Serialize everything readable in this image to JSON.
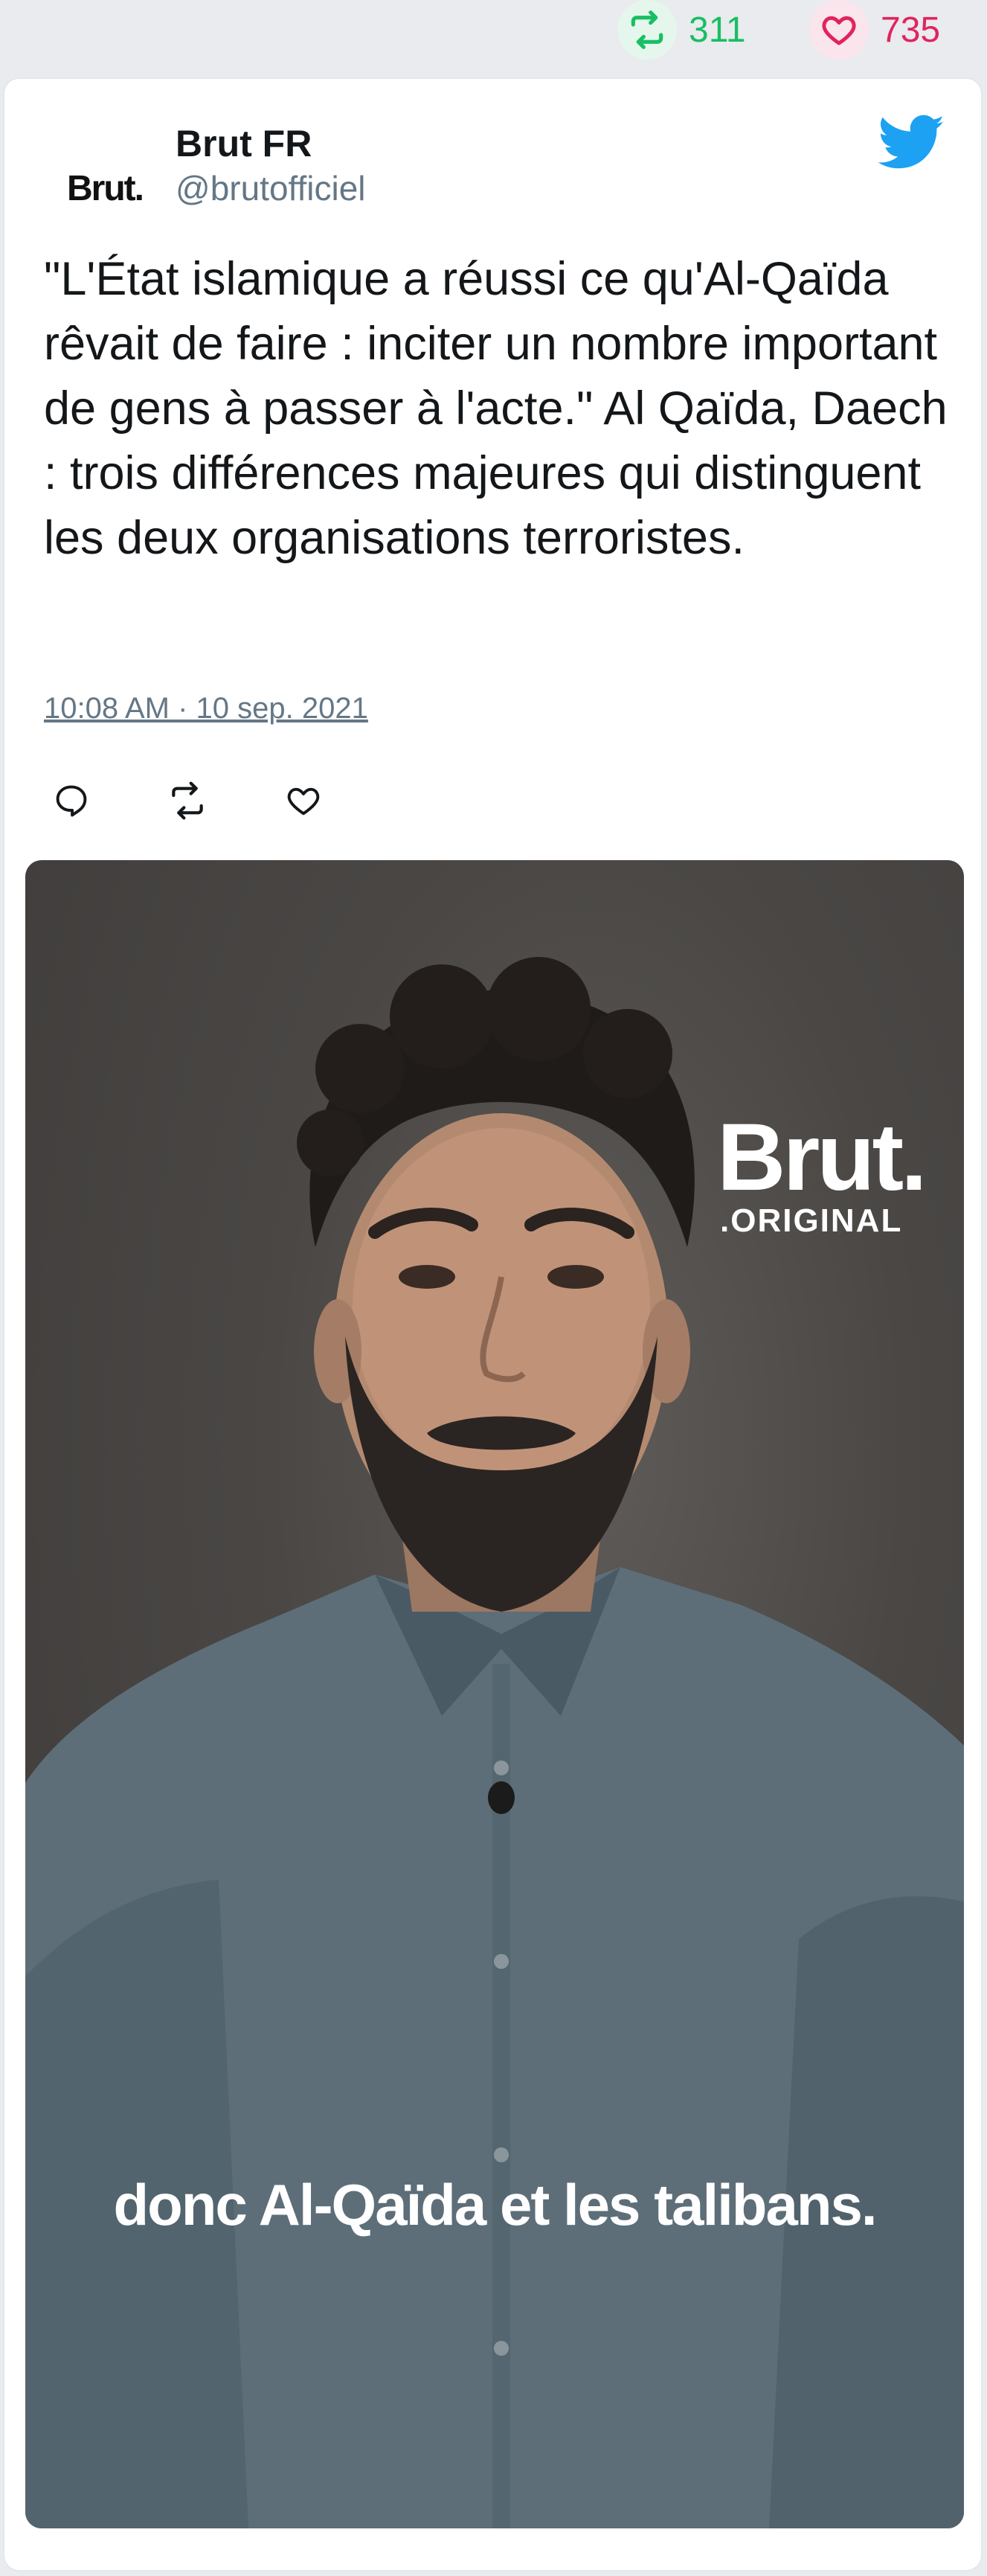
{
  "stats": {
    "retweets": "311",
    "likes": "735"
  },
  "tweet": {
    "avatar_text": "Brut.",
    "author_name": "Brut FR",
    "author_handle": "@brutofficiel",
    "text": "\"L'État islamique a réussi ce qu'Al-Qaïda rêvait de faire : inciter un nombre important de gens à passer à l'acte.\" Al Qaïda, Daech : trois différences majeures qui distinguent les deux organisations terroristes.",
    "timestamp": "10:08 AM · 10 sep. 2021"
  },
  "media": {
    "logo_main": "Brut.",
    "logo_sub": ".ORIGINAL",
    "subtitle": "donc Al-Qaïda et les talibans."
  },
  "icons": {
    "retweet": "retweet-icon",
    "like": "heart-icon",
    "reply": "reply-icon",
    "brand": "twitter-bird-icon"
  },
  "colors": {
    "retweet_green": "#17bf63",
    "like_red": "#e0245e",
    "twitter_blue": "#1da1f2",
    "muted_gray": "#657786"
  }
}
